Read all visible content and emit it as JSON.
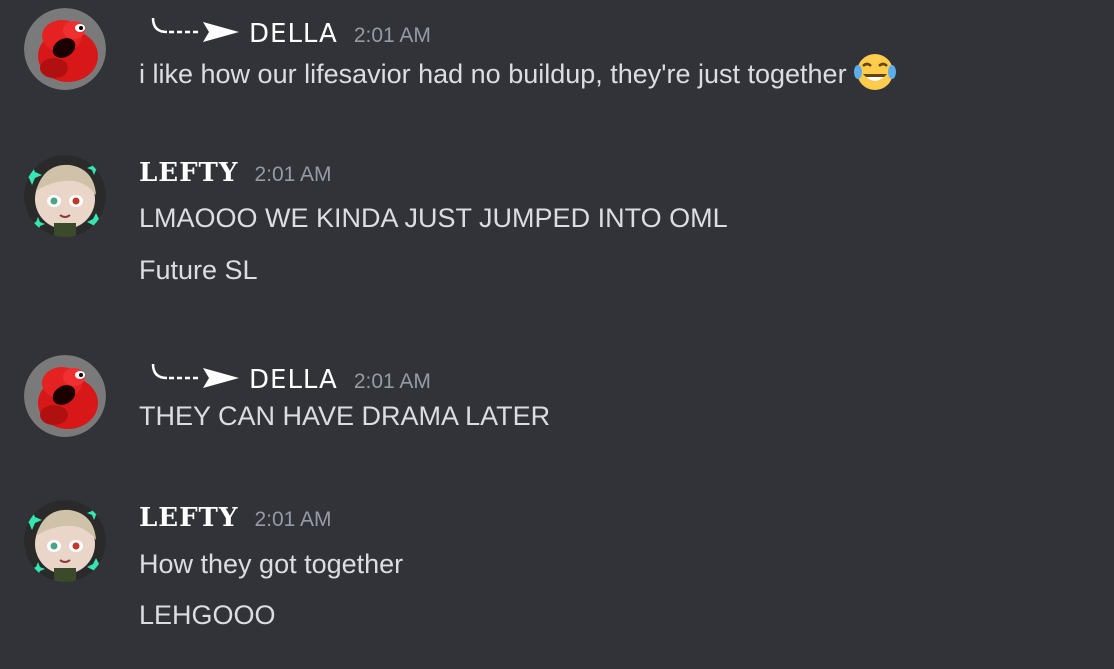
{
  "messages": [
    {
      "author": "DELLA",
      "time": "2:01 AM",
      "lines": [
        "i like how our lifesavior had no buildup, they're just together"
      ],
      "emoji": "joy-tears-emoji"
    },
    {
      "author": "LEFTY",
      "time": "2:01 AM",
      "lines": [
        "LMAOOO WE KINDA JUST JUMPED INTO OML",
        "Future SL"
      ]
    },
    {
      "author": "DELLA",
      "time": "2:01 AM",
      "lines": [
        "THEY CAN HAVE DRAMA LATER"
      ]
    },
    {
      "author": "LEFTY",
      "time": "2:01 AM",
      "lines": [
        "How they got together",
        "LEHGOOO"
      ]
    }
  ],
  "colors": {
    "background": "#323339",
    "username": "#ffffff",
    "message_text": "#dbdee1",
    "timestamp": "#949ba4"
  }
}
